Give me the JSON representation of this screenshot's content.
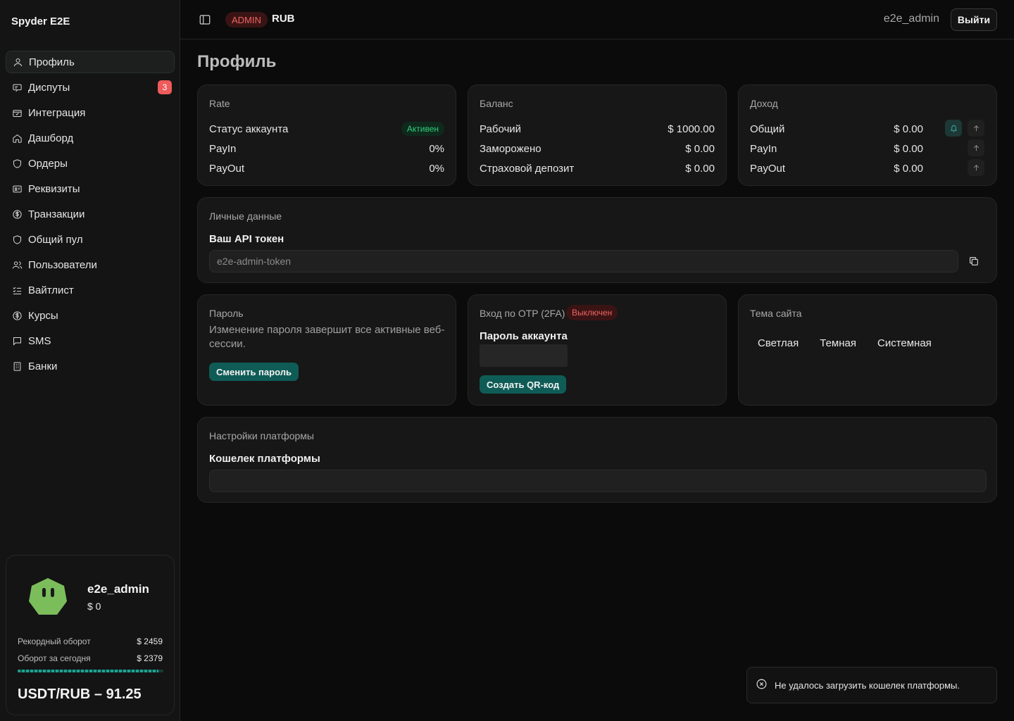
{
  "app": {
    "brand": "Spyder E2E"
  },
  "sidebar": {
    "items": [
      {
        "label": "Профиль",
        "icon": "user-icon",
        "active": true
      },
      {
        "label": "Диспуты",
        "icon": "disputes-icon",
        "badge": "3"
      },
      {
        "label": "Интеграция",
        "icon": "integration-icon"
      },
      {
        "label": "Дашборд",
        "icon": "home-icon"
      },
      {
        "label": "Ордеры",
        "icon": "shield-icon"
      },
      {
        "label": "Реквизиты",
        "icon": "id-card-icon"
      },
      {
        "label": "Транзакции",
        "icon": "dollar-icon"
      },
      {
        "label": "Общий пул",
        "icon": "shield-icon"
      },
      {
        "label": "Пользователи",
        "icon": "users-icon"
      },
      {
        "label": "Вайтлист",
        "icon": "checklist-icon"
      },
      {
        "label": "Курсы",
        "icon": "dollar-icon"
      },
      {
        "label": "SMS",
        "icon": "message-icon"
      },
      {
        "label": "Банки",
        "icon": "building-icon"
      }
    ],
    "user_card": {
      "username": "e2e_admin",
      "balance": "$ 0",
      "record_label": "Рекордный оборот",
      "record_value": "$ 2459",
      "today_label": "Оборот за сегодня",
      "today_value": "$ 2379",
      "progress_percent": 96.7,
      "rate_text": "USDT/RUB – 91.25"
    }
  },
  "header": {
    "role_badge": "ADMIN",
    "currency": "RUB",
    "username": "e2e_admin",
    "logout_label": "Выйти"
  },
  "page": {
    "title": "Профиль"
  },
  "rate_card": {
    "title": "Rate",
    "status_label": "Статус аккаунта",
    "status_value": "Активен",
    "payin_label": "PayIn",
    "payin_value": "0%",
    "payout_label": "PayOut",
    "payout_value": "0%"
  },
  "balance_card": {
    "title": "Баланс",
    "work_label": "Рабочий",
    "work_value": "$ 1000.00",
    "frozen_label": "Заморожено",
    "frozen_value": "$ 0.00",
    "deposit_label": "Страховой депозит",
    "deposit_value": "$ 0.00"
  },
  "income_card": {
    "title": "Доход",
    "total_label": "Общий",
    "total_value": "$ 0.00",
    "payin_label": "PayIn",
    "payin_value": "$ 0.00",
    "payout_label": "PayOut",
    "payout_value": "$ 0.00"
  },
  "personal_card": {
    "title": "Личные данные",
    "token_label": "Ваш API токен",
    "token_value": "e2e-admin-token"
  },
  "password_card": {
    "title": "Пароль",
    "description": "Изменение пароля завершит все активные веб-сессии.",
    "button_label": "Сменить пароль"
  },
  "otp_card": {
    "title": "Вход по OTP (2FA)",
    "status_badge": "Выключен",
    "password_label": "Пароль аккаунта",
    "button_label": "Создать QR-код"
  },
  "theme_card": {
    "title": "Тема сайта",
    "options": [
      "Светлая",
      "Темная",
      "Системная"
    ]
  },
  "platform_card": {
    "title": "Настройки платформы",
    "wallet_label": "Кошелек платформы",
    "wallet_value": ""
  },
  "toast": {
    "message": "Не удалось загрузить кошелек платформы."
  },
  "colors": {
    "accent": "#0f5c57",
    "danger": "#ef6363",
    "success": "#2fd07a"
  }
}
